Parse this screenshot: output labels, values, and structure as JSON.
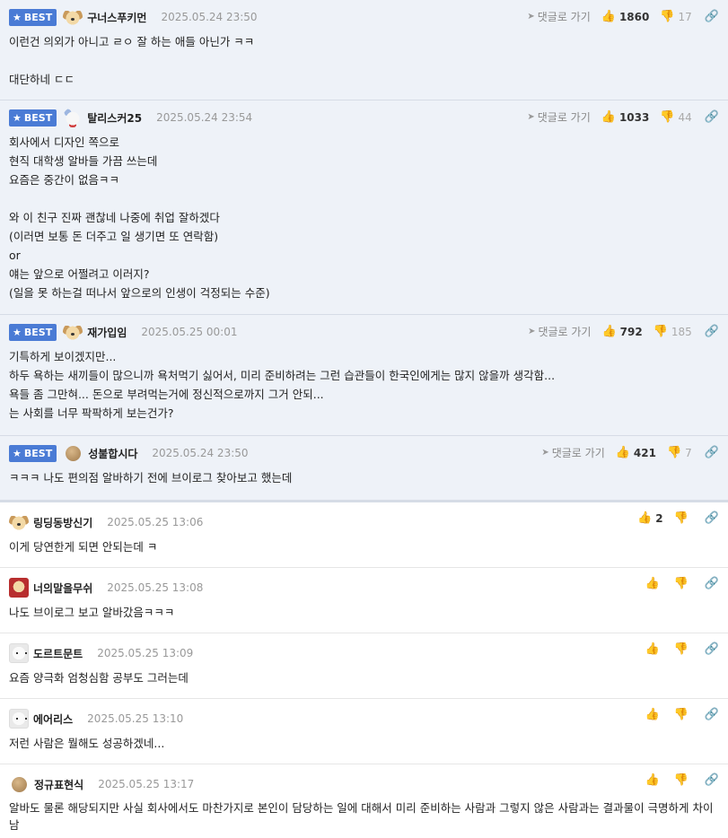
{
  "badge": {
    "label": "BEST",
    "star": "★"
  },
  "actions": {
    "reply": "댓글로 가기",
    "reply_icon": "➤",
    "like_icon": "👍",
    "dislike_icon": "👎",
    "share_icon": "🔗"
  },
  "best_comments": [
    {
      "avatar": "dog",
      "nick": "구너스푸키먼",
      "date": "2025.05.24 23:50",
      "likes": "1860",
      "dislikes": "17",
      "text": "이런건 의외가 아니고 ㄹㅇ 잘 하는 애들 아닌가 ㅋㅋ\n\n대단하네 ㄷㄷ"
    },
    {
      "avatar": "bear",
      "nick": "탈리스커25",
      "date": "2025.05.24 23:54",
      "likes": "1033",
      "dislikes": "44",
      "text": "회사에서 디자인 쪽으로\n현직 대학생 알바들 가끔 쓰는데\n요즘은 중간이 없음ㅋㅋ\n\n와 이 친구 진짜 괜찮네 나중에 취업 잘하겠다\n(이러면 보통 돈 더주고 일 생기면 또 연락함)\nor\n얘는 앞으로 어쩔려고 이러지?\n(일을 못 하는걸 떠나서 앞으로의 인생이 걱정되는 수준)"
    },
    {
      "avatar": "dog",
      "nick": "재가입임",
      "date": "2025.05.25 00:01",
      "likes": "792",
      "dislikes": "185",
      "text": "기특하게 보이겠지만...\n하두 욕하는 새끼들이 많으니까 욕처먹기 싫어서, 미리 준비하려는 그런 습관들이 한국인에게는 많지 않을까 생각함...\n욕들 좀 그만혀... 돈으로 부려먹는거에 정신적으로까지 그거 안되...\n는 사회를 너무 팍팍하게 보는건가?"
    },
    {
      "avatar": "ball",
      "nick": "성불합시다",
      "date": "2025.05.24 23:50",
      "likes": "421",
      "dislikes": "7",
      "text": "ㅋㅋㅋ 나도 편의점 알바하기 전에 브이로그 찾아보고 했는데"
    }
  ],
  "comments": [
    {
      "avatar": "dog",
      "nick": "링딩동방신기",
      "date": "2025.05.25 13:06",
      "likes": "2",
      "text": "이게 당연한게 되면 안되는데 ㅋ"
    },
    {
      "avatar": "redbox",
      "nick": "너의말을무쉬",
      "date": "2025.05.25 13:08",
      "likes": "",
      "text": "나도 브이로그 보고 알바갔음ㅋㅋㅋ"
    },
    {
      "avatar": "white",
      "nick": "도르트문트",
      "date": "2025.05.25 13:09",
      "likes": "",
      "text": "요즘 양극화 엄청심함 공부도 그러는데"
    },
    {
      "avatar": "white",
      "nick": "에어리스",
      "date": "2025.05.25 13:10",
      "likes": "",
      "text": "저런 사람은 뭘해도 성공하겠네..."
    },
    {
      "avatar": "ball",
      "nick": "정규표현식",
      "date": "2025.05.25 13:17",
      "likes": "",
      "text": "알바도 물론 해당되지만 사실 회사에서도 마찬가지로 본인이 담당하는 일에 대해서 미리 준비하는 사람과 그렇지 않은 사람과는 결과물이 극명하게 차이남"
    }
  ]
}
